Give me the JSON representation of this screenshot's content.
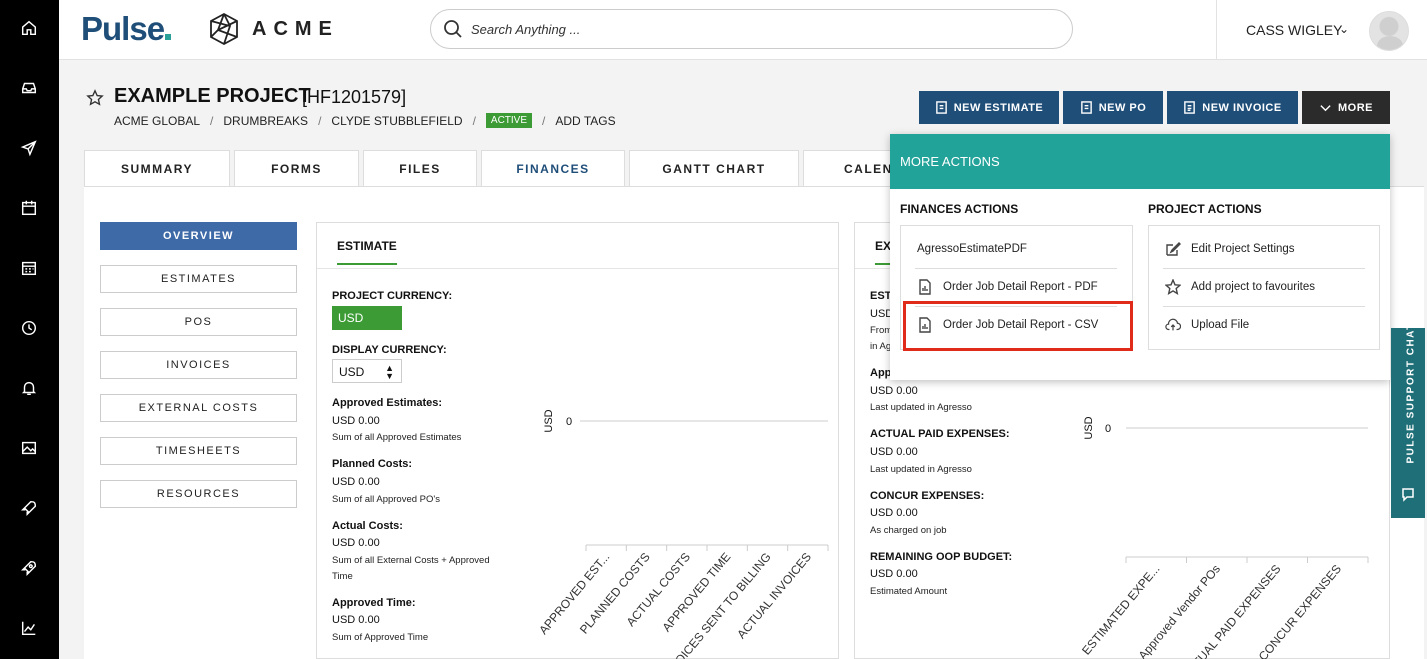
{
  "brand": {
    "logo": "Pulse",
    "company": "ACME"
  },
  "search": {
    "placeholder": "Search Anything ..."
  },
  "user": {
    "name": "CASS WIGLEY",
    "chevron": "⌄"
  },
  "rail": {
    "icons": [
      "home-icon",
      "inbox-icon",
      "send-icon",
      "calendar-icon",
      "schedule-icon",
      "clock-icon",
      "bell-icon",
      "image-icon",
      "rocket-icon",
      "rocket-alt-icon",
      "chart-icon"
    ]
  },
  "project": {
    "title": "EXAMPLE PROJECT",
    "code": "[HF1201579]",
    "breadcrumbs": [
      "ACME GLOBAL",
      "DRUMBREAKS",
      "CLYDE STUBBLEFIELD"
    ],
    "status": "ACTIVE",
    "add_tags": "ADD TAGS"
  },
  "actions": {
    "new_estimate": "NEW ESTIMATE",
    "new_po": "NEW PO",
    "new_invoice": "NEW INVOICE",
    "more": "MORE"
  },
  "tabs": [
    "SUMMARY",
    "FORMS",
    "FILES",
    "FINANCES",
    "GANTT CHART",
    "CALEND"
  ],
  "active_tab": "FINANCES",
  "sidebar": [
    "OVERVIEW",
    "ESTIMATES",
    "POS",
    "INVOICES",
    "EXTERNAL COSTS",
    "TIMESHEETS",
    "RESOURCES"
  ],
  "estimate_card": {
    "tab": "ESTIMATE",
    "project_currency_label": "PROJECT CURRENCY:",
    "project_currency": "USD",
    "display_currency_label": "DISPLAY CURRENCY:",
    "display_currency": "USD",
    "metrics": [
      {
        "label": "Approved Estimates:",
        "value": "USD 0.00",
        "note": "Sum of all Approved Estimates"
      },
      {
        "label": "Planned Costs:",
        "value": "USD 0.00",
        "note": "Sum of all Approved PO's"
      },
      {
        "label": "Actual Costs:",
        "value": "USD 0.00",
        "note": "Sum of all External Costs + Approved",
        "note2": "Time"
      },
      {
        "label": "Approved Time:",
        "value": "USD 0.00",
        "note": "Sum of Approved Time"
      }
    ]
  },
  "expense_card": {
    "tab": "EX",
    "partial_top": [
      "EST",
      "USD",
      "From",
      "in Ag"
    ],
    "partial_appr": "App",
    "appr_value": "USD 0.00",
    "appr_note": "Last updated in Agresso",
    "metrics": [
      {
        "label": "ACTUAL PAID EXPENSES:",
        "value": "USD 0.00",
        "note": "Last updated in Agresso"
      },
      {
        "label": "CONCUR EXPENSES:",
        "value": "USD 0.00",
        "note": "As charged on job"
      },
      {
        "label": "REMAINING OOP BUDGET:",
        "value": "USD 0.00",
        "note": "Estimated Amount"
      }
    ]
  },
  "chart_data": [
    {
      "type": "bar",
      "ylabel": "USD",
      "categories": [
        "APPROVED EST...",
        "PLANNED COSTS",
        "ACTUAL COSTS",
        "APPROVED TIME",
        "INVOICES SENT TO BILLING",
        "ACTUAL INVOICES"
      ],
      "values": [
        0,
        0,
        0,
        0,
        0,
        0
      ],
      "yticks": [
        "0"
      ]
    },
    {
      "type": "bar",
      "ylabel": "USD",
      "categories": [
        "ESTIMATED EXPE...",
        "Approved Vendor POs",
        "ACTUAL PAID EXPENSES",
        "CONCUR EXPENSES"
      ],
      "values": [
        0,
        0,
        0,
        0
      ],
      "yticks": [
        "0"
      ]
    }
  ],
  "more_actions": {
    "title": "MORE ACTIONS",
    "finances_title": "FINANCES ACTIONS",
    "project_title": "PROJECT ACTIONS",
    "finances": [
      "AgressoEstimatePDF",
      "Order Job Detail Report - PDF",
      "Order Job Detail Report - CSV"
    ],
    "project": [
      "Edit Project Settings",
      "Add project to favourites",
      "Upload File"
    ]
  },
  "support": {
    "label": "PULSE SUPPORT CHAT"
  },
  "colors": {
    "navy": "#1f4e79",
    "teal": "#22a39a",
    "green": "#3d9b35",
    "highlight": "#e02b1b"
  }
}
